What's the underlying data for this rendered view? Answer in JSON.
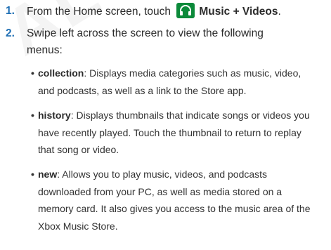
{
  "watermark": "AL USE",
  "steps": [
    {
      "number": "1.",
      "pre": "From the Home screen, touch",
      "app_name": "Music + Videos",
      "post": "."
    },
    {
      "number": "2.",
      "line1": "Swipe left across the screen to view the following",
      "line2": "menus:"
    }
  ],
  "bullets": [
    {
      "term": "collection",
      "line1": ": Displays media categories such as music, video,",
      "line2": "and podcasts, as well as a link to the Store app."
    },
    {
      "term": "history",
      "line1": ": Displays thumbnails that indicate songs or videos you",
      "line2": "have recently played. Touch the thumbnail to return to replay",
      "line3": "that song or video."
    },
    {
      "term": "new",
      "line1": ": Allows you to play music, videos, and podcasts",
      "line2": "downloaded from your PC, as well as media stored on a",
      "line3": "memory card. It also gives you access to the music area of the",
      "line4": "Xbox Music Store."
    }
  ],
  "colors": {
    "step_number": "#1f6fb4",
    "app_icon": "#0c8a3a"
  },
  "icons": {
    "app": "headphones-icon"
  }
}
